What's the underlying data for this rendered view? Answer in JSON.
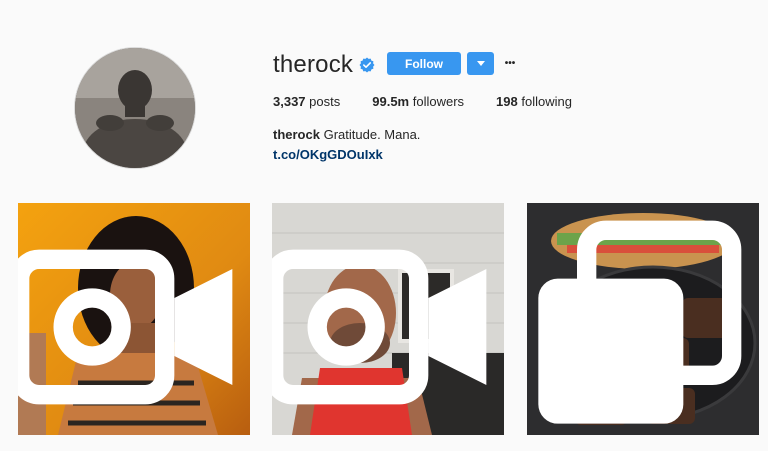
{
  "profile": {
    "username": "therock",
    "verified_icon": "verified-badge-icon",
    "follow_label": "Follow",
    "more_label": "•••",
    "stats": {
      "posts_count": "3,337",
      "posts_label": "posts",
      "followers_count": "99.5m",
      "followers_label": "followers",
      "following_count": "198",
      "following_label": "following"
    },
    "bio": {
      "name": "therock",
      "text": "Gratitude. Mana."
    },
    "link": "t.co/OKgGDOuIxk"
  },
  "posts": [
    {
      "type": "video",
      "icon": "video-camera-icon"
    },
    {
      "type": "video",
      "icon": "video-camera-icon"
    },
    {
      "type": "carousel",
      "icon": "multiple-images-icon"
    }
  ],
  "colors": {
    "accent": "#3897f0",
    "link": "#003569",
    "background": "#fafafa",
    "text": "#262626"
  }
}
